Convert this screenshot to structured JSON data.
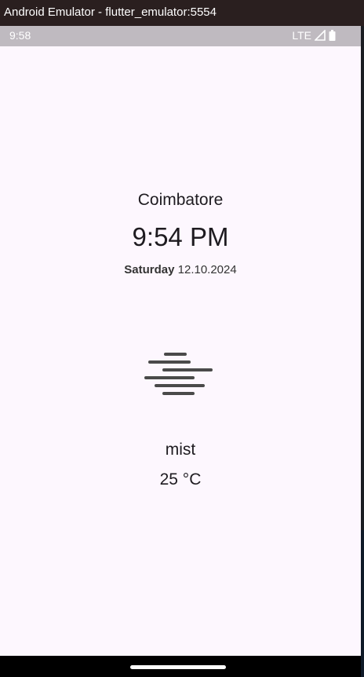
{
  "window": {
    "title": "Android Emulator - flutter_emulator:5554"
  },
  "status_bar": {
    "time": "9:58",
    "network": "LTE",
    "icons": [
      "signal-icon",
      "battery-icon"
    ]
  },
  "weather": {
    "city": "Coimbatore",
    "time": "9:54 PM",
    "day": "Saturday",
    "date": "12.10.2024",
    "condition_icon": "mist-icon",
    "condition": "mist",
    "temperature": "25 °C"
  }
}
